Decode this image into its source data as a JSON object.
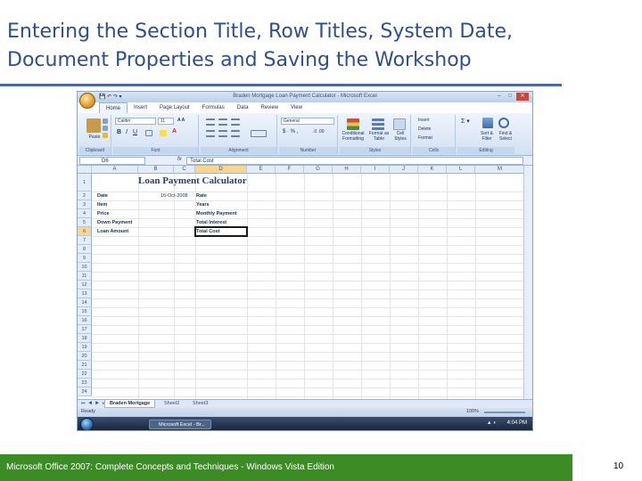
{
  "slide": {
    "title": "Entering the Section Title, Row Titles, System Date, Document Properties and Saving the Workshop",
    "footer": "Microsoft Office 2007: Complete Concepts and Techniques - Windows Vista Edition",
    "page_number": "10"
  },
  "excel": {
    "window_title": "Braden Mortgage Loan Payment Calculator - Microsoft Excel",
    "tabs": [
      "Home",
      "Insert",
      "Page Layout",
      "Formulas",
      "Data",
      "Review",
      "View"
    ],
    "ribbon": {
      "clipboard": {
        "label": "Clipboard",
        "paste": "Paste"
      },
      "font": {
        "label": "Font",
        "font_name": "Calibri",
        "font_size": "11"
      },
      "alignment": {
        "label": "Alignment"
      },
      "number": {
        "label": "Number",
        "format": "General"
      },
      "styles": {
        "label": "Styles",
        "conditional": "Conditional Formatting",
        "format_table": "Format as Table",
        "cell_styles": "Cell Styles"
      },
      "cells": {
        "label": "Cells",
        "insert": "Insert",
        "delete": "Delete",
        "format": "Format"
      },
      "editing": {
        "label": "Editing",
        "sort": "Sort & Filter",
        "find": "Find & Select"
      }
    },
    "name_box": "D6",
    "fx": "fx",
    "formula": "Total Cost",
    "columns": [
      "A",
      "B",
      "C",
      "D",
      "E",
      "F",
      "G",
      "H",
      "I",
      "J",
      "K",
      "L",
      "M"
    ],
    "rows": [
      "1",
      "2",
      "3",
      "4",
      "5",
      "6",
      "7",
      "8",
      "9",
      "10",
      "11",
      "12",
      "13",
      "14",
      "15",
      "16",
      "17",
      "18",
      "19",
      "20",
      "21",
      "22",
      "23",
      "24"
    ],
    "sheet_title": "Loan Payment Calculator",
    "cells": {
      "b2": "Date",
      "c2": "16-Oct-2008",
      "d2": "Rate",
      "b3": "Item",
      "d3": "Years",
      "b4": "Price",
      "d4": "Monthly Payment",
      "b5": "Down Payment",
      "d5": "Total Interest",
      "b6": "Loan Amount",
      "d6": "Total Cost"
    },
    "sheet_tabs": [
      "Braden Mortgage",
      "Sheet2",
      "Sheet3"
    ],
    "status": "Ready",
    "zoom": "100%",
    "taskbar_item": "Microsoft Excel - Br...",
    "clock": "4:04 PM"
  }
}
